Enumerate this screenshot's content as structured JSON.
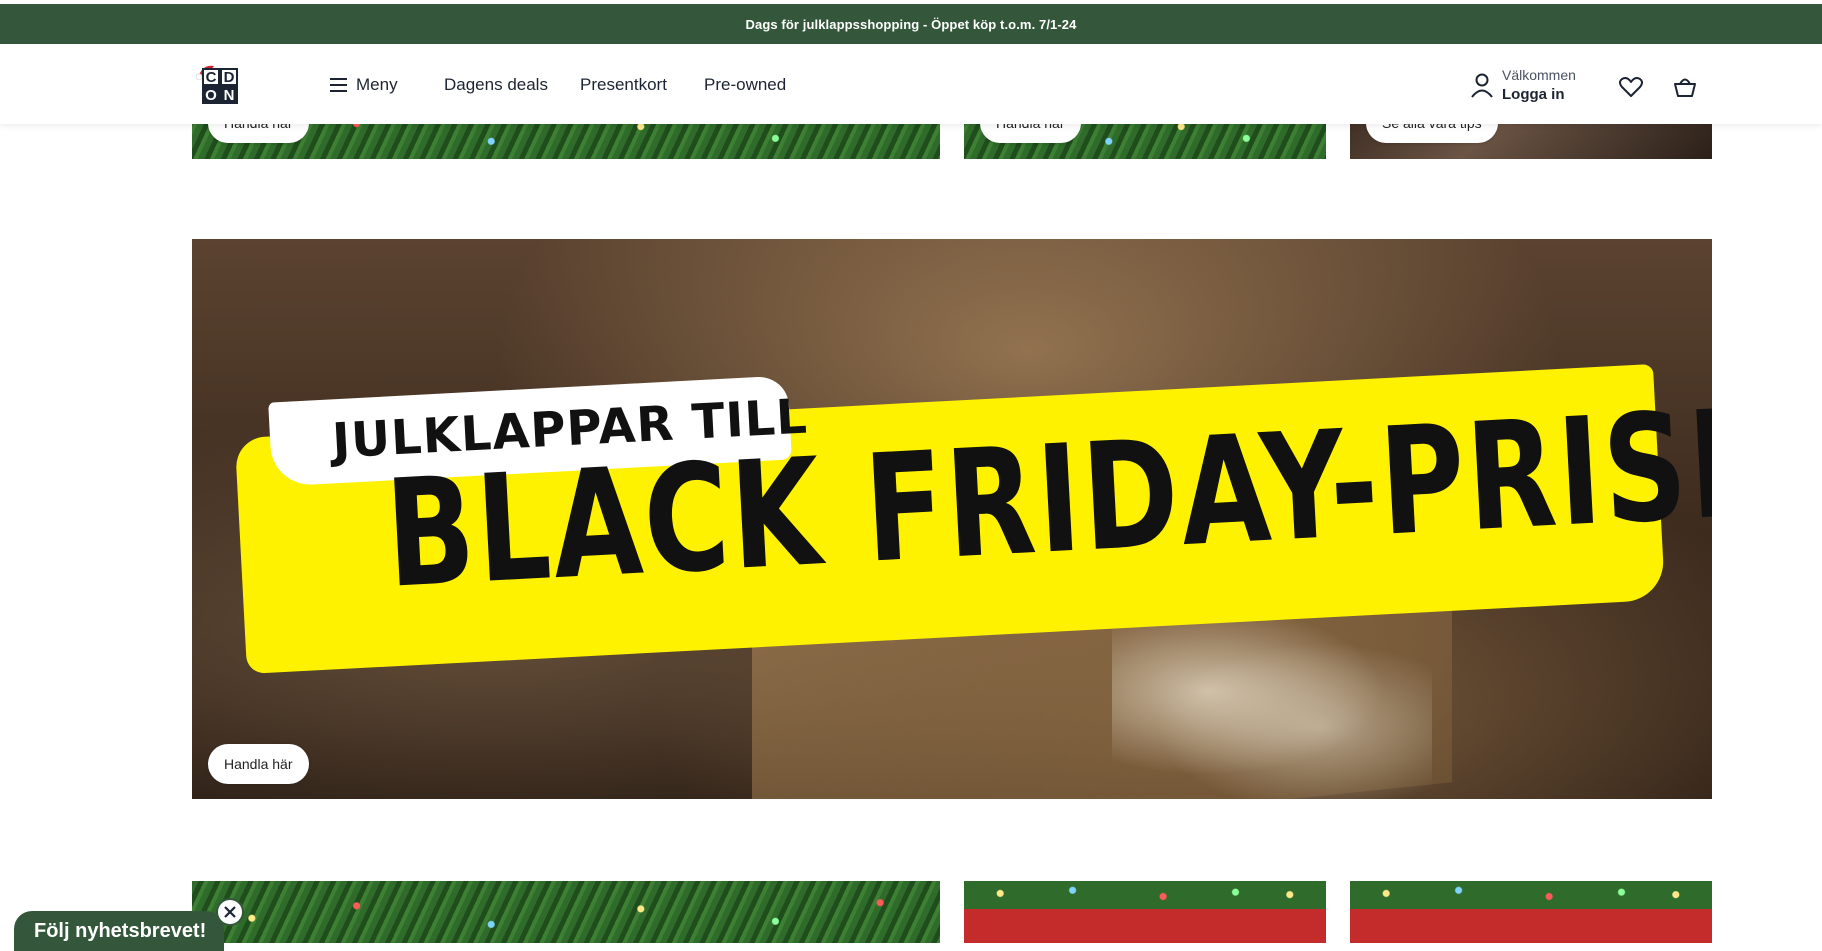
{
  "promo_bar": {
    "text": "Dags för julklappsshopping - Öppet köp t.o.m. 7/1-24"
  },
  "header": {
    "logo_letters": [
      "C",
      "D",
      "O",
      "N"
    ],
    "menu_label": "Meny",
    "nav": [
      "Dagens deals",
      "Presentkort",
      "Pre-owned"
    ],
    "account_greeting": "Välkommen",
    "account_action": "Logga in",
    "icons": [
      "user-icon",
      "heart-icon",
      "basket-icon",
      "hamburger-icon"
    ]
  },
  "top_tiles": {
    "buttons": [
      "Handla här",
      "Handla här",
      "Se alla våra tips"
    ]
  },
  "hero": {
    "subtitle": "JULKLAPPAR TILL",
    "title": "BLACK FRIDAY-PRISER",
    "button": "Handla här"
  },
  "newsletter": {
    "label": "Följ nyhetsbrevet!",
    "close_icon": "close-icon"
  },
  "colors": {
    "brand_green": "#34573b",
    "banner_yellow": "#fff200",
    "text_dark": "#1c2433"
  }
}
